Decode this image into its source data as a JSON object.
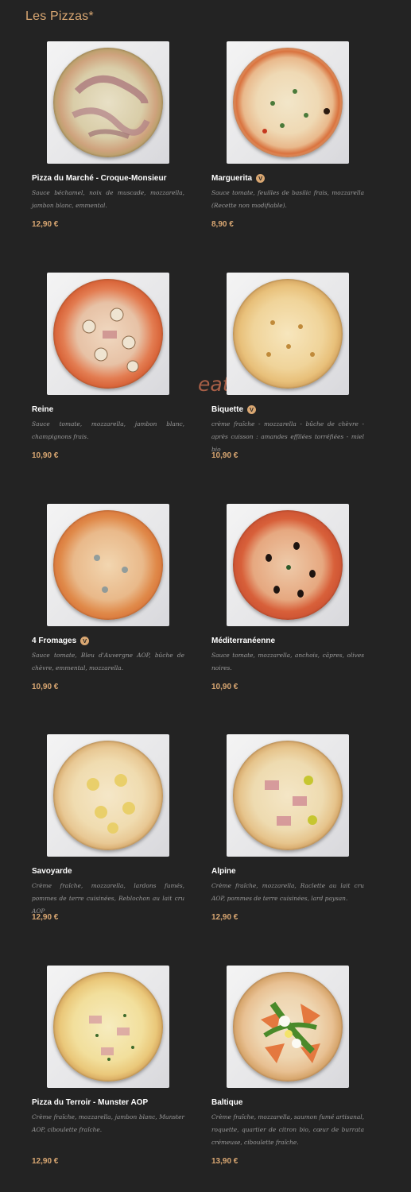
{
  "section": {
    "title": "Les Pizzas*"
  },
  "watermark": "eat-list.fr",
  "pizzas": [
    {
      "name": "Pizza du Marché - Croque-Monsieur",
      "vegetarian": false,
      "description": "Sauce béchamel, noix de muscade, mozzarella, jambon blanc, emmental.",
      "price": "12,90 €"
    },
    {
      "name": "Marguerita",
      "vegetarian": true,
      "badge": "V",
      "description": "Sauce tomate, feuilles de basilic frais, mozzarella (Recette non modifiable).",
      "price": "8,90 €"
    },
    {
      "name": "Reine",
      "vegetarian": false,
      "description": "Sauce tomate, mozzarella, jambon blanc, champignons frais.",
      "price": "10,90 €"
    },
    {
      "name": "Biquette",
      "vegetarian": true,
      "badge": "V",
      "description": "crème fraîche - mozzarella - bûche de chèvre - après cuisson : amandes effilées torréfiées - miel bio",
      "price": "10,90 €"
    },
    {
      "name": "4 Fromages",
      "vegetarian": true,
      "badge": "V",
      "description": "Sauce tomate, Bleu d'Auvergne AOP, bûche de chèvre, emmental, mozzarella.",
      "price": "10,90 €"
    },
    {
      "name": "Méditerranéenne",
      "vegetarian": false,
      "description": "Sauce tomate, mozzarella, anchois, câpres, olives noires.",
      "price": "10,90 €"
    },
    {
      "name": "Savoyarde",
      "vegetarian": false,
      "description": "Crème fraîche, mozzarella, lardons fumés, pommes de terre cuisinées, Reblochon au lait cru AOP",
      "price": "12,90 €"
    },
    {
      "name": "Alpine",
      "vegetarian": false,
      "description": "Crème fraîche, mozzarella, Raclette au lait cru AOP, pommes de terre cuisinées, lard paysan.",
      "price": "12,90 €"
    },
    {
      "name": "Pizza du Terroir - Munster AOP",
      "vegetarian": false,
      "description": "Crème fraîche, mozzarella, jambon blanc, Munster AOP, ciboulette fraîche.",
      "price": "12,90 €"
    },
    {
      "name": "Baltique",
      "vegetarian": false,
      "description": "Crème fraîche, mozzarella, saumon fumé artisanal, roquette, quartier de citron bio, cœur de burrata crémeuse, ciboulette fraîche.",
      "price": "13,90 €"
    }
  ]
}
